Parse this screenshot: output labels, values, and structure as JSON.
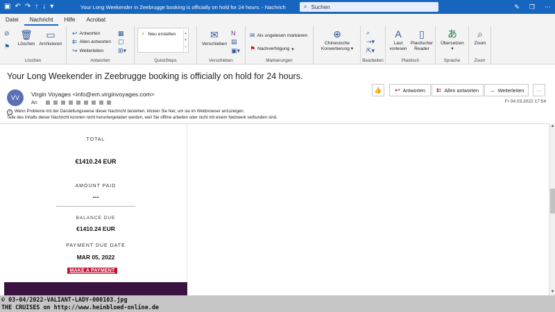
{
  "titlebar": {
    "title": "Your Long Weekender in Zeebrugge booking is officially on hold for 24 hours.  -  Nachricht (HTML)",
    "search_label": "Suchen",
    "icons": [
      "save-icon",
      "undo-icon",
      "redo-icon",
      "up-arrow-icon",
      "down-arrow-icon",
      "dropdown-icon"
    ],
    "right_icons": [
      "pen-icon",
      "restore-icon",
      "more-icon"
    ]
  },
  "menu": {
    "tabs": [
      "Datei",
      "Nachricht",
      "Hilfe",
      "Acrobat"
    ],
    "active": "Nachricht"
  },
  "ribbon": {
    "loeschen": {
      "label": "Löschen",
      "delete_btn": "Löschen",
      "archive_btn": "Archivieren"
    },
    "antworten": {
      "label": "Antworten",
      "reply": "Antworten",
      "reply_all": "Allen antworten",
      "forward": "Weiterleiten"
    },
    "quicksteps": {
      "label": "QuickSteps",
      "new": "Neu erstellen"
    },
    "verschieben": {
      "label": "Verschieben",
      "move": "Verschieben"
    },
    "markierungen": {
      "label": "Markierungen",
      "unread": "Als ungelesen markieren",
      "followup": "Nachverfolgung"
    },
    "chinese": {
      "line1": "Chinesische",
      "line2": "Konvertierung"
    },
    "bearbeiten": {
      "label": "Bearbeiten"
    },
    "plastisch": {
      "label": "Plastisch",
      "read_aloud_1": "Laut",
      "read_aloud_2": "vorlesen",
      "reader_1": "Plastischer",
      "reader_2": "Reader"
    },
    "sprache": {
      "label": "Sprache",
      "translate": "Übersetzen"
    },
    "zoom": {
      "label": "Zoom",
      "zoom": "Zoom"
    }
  },
  "message": {
    "subject": "Your Long Weekender in Zeebrugge booking is officially on hold for 24 hours.",
    "avatar_initials": "VV",
    "sender": "Virgin Voyages <info@em.virginvoyages.com>",
    "to_label": "An",
    "date": "Fr 04.03.2022 17:54",
    "info_line1": "Wenn Probleme mit der Darstellungsweise dieser Nachricht bestehen, klicken Sie hier, um sie im Webbrowser anzuzeigen.",
    "info_line2": "Teile des Inhalts dieser Nachricht konnten nicht heruntergeladen werden, weil Sie offline arbeiten oder nicht mit einem Netzwerk verbunden sind.",
    "actions": {
      "reply": "Antworten",
      "reply_all": "Allen antworten",
      "forward": "Weiterleiten",
      "more": "···"
    }
  },
  "email_body": {
    "total_label": "TOTAL",
    "total_value": "€1410.24 EUR",
    "amount_paid_label": "AMOUNT PAID",
    "amount_paid_value": "---",
    "balance_due_label": "BALANCE DUE",
    "balance_due_value": "€1410.24 EUR",
    "payment_due_label": "PAYMENT DUE DATE",
    "payment_due_value": "MAR 05, 2022",
    "pay_button": "MAKE A PAYMENT"
  },
  "caption": {
    "line1": "© 03-04/2022-VALIANT-LADY-000103.jpg",
    "line2": "THE CRUISES on http://www.heinbloed-online.de"
  },
  "colors": {
    "titlebar": "#1666c0",
    "pay_button": "#c8102e",
    "footer_band": "#3a1340",
    "avatar": "#5b6fb6"
  }
}
